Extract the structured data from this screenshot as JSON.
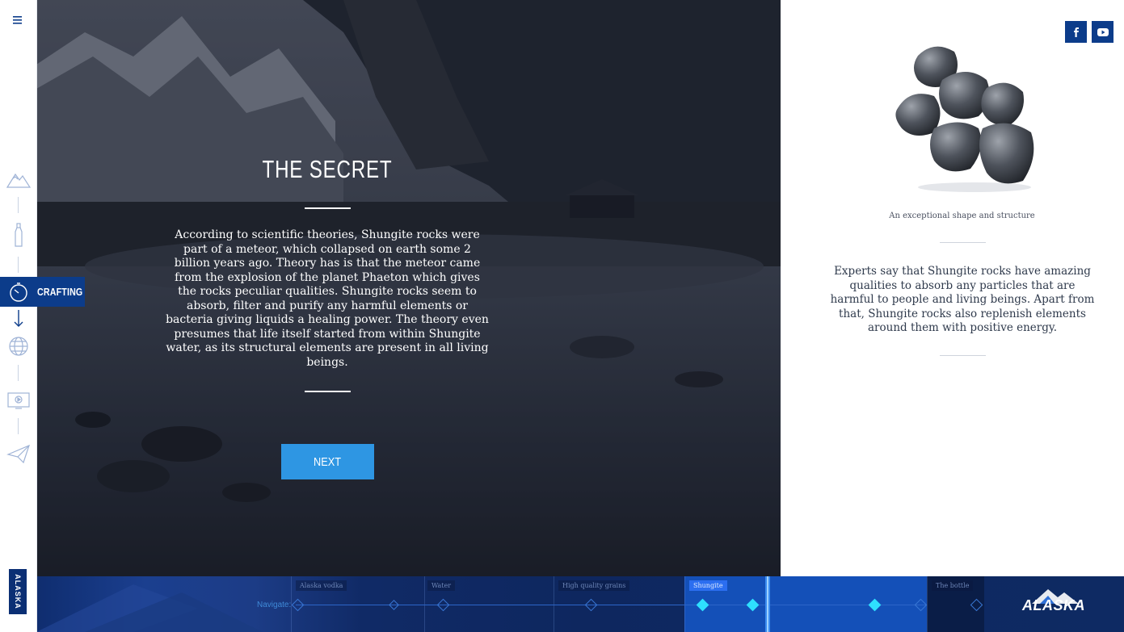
{
  "sidebar": {
    "active_item": "CRAFTING",
    "logo_text": "ALASKA"
  },
  "hero": {
    "title": "THE SECRET",
    "body": "According to scientific theories, Shungite rocks were part of a meteor, which collapsed on earth some 2 billion years ago. Theory has is that the meteor came from the explosion of the planet Phaeton which gives the rocks peculiar qualities. Shungite rocks seem to absorb, filter and purify any harmful elements or bacteria giving liquids a healing power. The theory even presumes that life itself started from within Shungite water, as its structural elements are present in all living beings.",
    "next_label": "NEXT"
  },
  "panel": {
    "image_caption": "An exceptional shape and structure",
    "body": "Experts say that Shungite rocks have amazing qualities to absorb any particles that are harmful to people and living beings. Apart from that, Shungite rocks also replenish elements around them with positive energy."
  },
  "navigator": {
    "label": "Navigate:",
    "sections": [
      "Alaska vodka",
      "Water",
      "High quality grains",
      "Shungite",
      "The bottle"
    ],
    "active_section": "Shungite",
    "brand": "ALASKA"
  },
  "colors": {
    "brand_blue": "#0c3c8a",
    "button_blue": "#2e96e3",
    "nav_active": "#1450b8",
    "marker_on": "#2ee0ff"
  },
  "icons": [
    "menu-icon",
    "mountain-icon",
    "bottle-icon",
    "clock-icon",
    "arrow-down-icon",
    "globe-icon",
    "video-icon",
    "paper-plane-icon",
    "facebook-icon",
    "youtube-icon"
  ]
}
